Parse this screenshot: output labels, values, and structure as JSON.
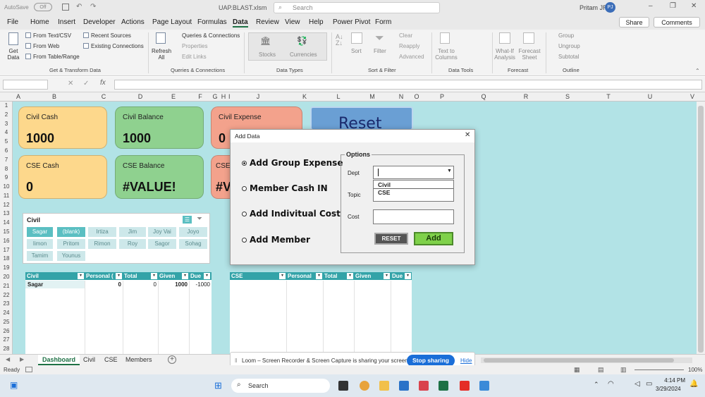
{
  "window": {
    "autosave": "AutoSave",
    "autosave_state": "Off",
    "filename": "UAP.BLAST.xlsm",
    "search_placeholder": "Search",
    "user": "Pritam JR",
    "user_initials": "PJ"
  },
  "menu": {
    "tabs": [
      "File",
      "Home",
      "Insert",
      "Developer",
      "Actions",
      "Page Layout",
      "Formulas",
      "Data",
      "Review",
      "View",
      "Help",
      "Power Pivot",
      "Form"
    ],
    "active": "Data",
    "share": "Share",
    "comments": "Comments"
  },
  "ribbon": {
    "get_data": "Get Data",
    "from_text": "From Text/CSV",
    "from_web": "From Web",
    "from_table": "From Table/Range",
    "recent_sources": "Recent Sources",
    "existing_connections": "Existing Connections",
    "refresh_all": "Refresh All",
    "queries_connections": "Queries & Connections",
    "properties": "Properties",
    "edit_links": "Edit Links",
    "stocks": "Stocks",
    "currencies": "Currencies",
    "sort": "Sort",
    "filter": "Filter",
    "clear": "Clear",
    "reapply": "Reapply",
    "advanced": "Advanced",
    "text_to_columns": "Text to Columns",
    "what_if": "What-If Analysis",
    "forecast_sheet": "Forecast Sheet",
    "group": "Group",
    "ungroup": "Ungroup",
    "subtotal": "Subtotal",
    "groups": [
      "Get & Transform Data",
      "Queries & Connections",
      "Data Types",
      "Sort & Filter",
      "Data Tools",
      "Forecast",
      "Outline"
    ]
  },
  "columns": [
    "A",
    "B",
    "C",
    "D",
    "E",
    "F",
    "G",
    "H",
    "I",
    "J",
    "K",
    "L",
    "M",
    "N",
    "O",
    "P",
    "Q",
    "R",
    "S",
    "T",
    "U",
    "V"
  ],
  "rows": [
    "1",
    "2",
    "3",
    "4",
    "5",
    "6",
    "7",
    "8",
    "9",
    "10",
    "11",
    "12",
    "13",
    "14",
    "15",
    "16",
    "17",
    "18",
    "19",
    "20",
    "21",
    "22",
    "23",
    "24",
    "25",
    "26",
    "27",
    "28"
  ],
  "cards": [
    {
      "title": "Civil Cash",
      "value": "1000",
      "color": "#fdd88c"
    },
    {
      "title": "Civil Balance",
      "value": "1000",
      "color": "#8fd18f"
    },
    {
      "title": "Civil Expense",
      "value": "0",
      "color": "#f3a28c"
    },
    {
      "title": "CSE Cash",
      "value": "0",
      "color": "#fdd88c"
    },
    {
      "title": "CSE Balance",
      "value": "#VALUE!",
      "color": "#8fd18f"
    },
    {
      "title": "CSE",
      "value": "#V",
      "color": "#f3a28c"
    }
  ],
  "reset_button": "Reset",
  "slicer": {
    "title": "Civil",
    "items": [
      "Sagar",
      "(blank)",
      "Irtiza",
      "Jim",
      "Joy Vai",
      "Joyo",
      "Iimon",
      "Pritom",
      "Rimon",
      "Roy",
      "Sagor",
      "Sohag",
      "Tamim",
      "Younus"
    ]
  },
  "civil_table": {
    "headers": [
      "Civil",
      "Personal (",
      "Total",
      "Given",
      "Due"
    ],
    "row": [
      "Sagar",
      "0",
      "0",
      "1000",
      "-1000"
    ]
  },
  "cse_table": {
    "headers": [
      "CSE",
      "Personal",
      "Total",
      "Given",
      "Due"
    ]
  },
  "dialog": {
    "title": "Add Data",
    "options": [
      "Add Group Expense",
      "Member Cash IN",
      "Add Indivitual Cost",
      "Add Member"
    ],
    "group_label": "Options",
    "dept_label": "Dept",
    "topic_label": "Topic",
    "cost_label": "Cost",
    "dept_options": [
      "Civil",
      "CSE"
    ],
    "reset": "RESET",
    "add": "Add"
  },
  "sheet_tabs": [
    "Dashboard",
    "Civil",
    "CSE",
    "Members"
  ],
  "active_sheet": "Dashboard",
  "status": "Ready",
  "zoom": "100%",
  "loom": {
    "text": "Loom – Screen Recorder & Screen Capture is sharing your screen.",
    "stop": "Stop sharing",
    "hide": "Hide"
  },
  "taskbar": {
    "search": "Search",
    "time": "4:14 PM",
    "date": "3/29/2024"
  }
}
